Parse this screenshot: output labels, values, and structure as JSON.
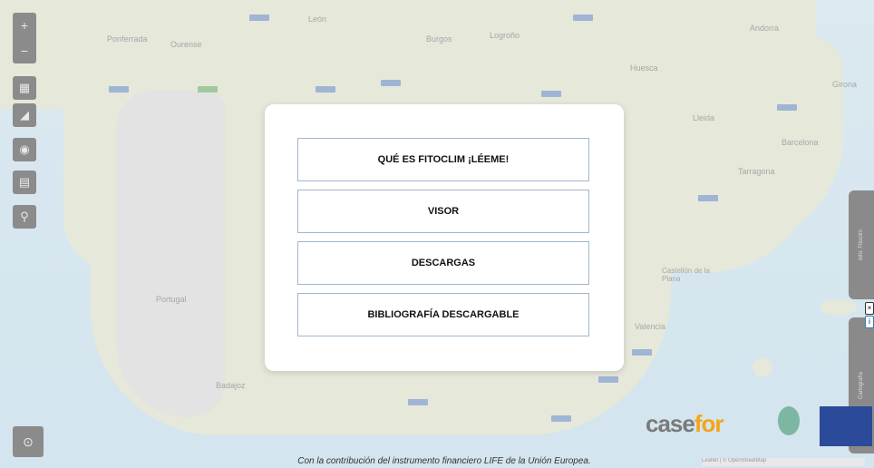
{
  "modal": {
    "buttons": [
      {
        "label": "QUÉ ES FITOCLIM ¡LÉEME!"
      },
      {
        "label": "VISOR"
      },
      {
        "label": "DESCARGAS"
      },
      {
        "label": "BIBLIOGRAFÍA DESCARGABLE"
      }
    ]
  },
  "map": {
    "labels": {
      "portugal": "Portugal",
      "barcelona": "Barcelona",
      "tarragona": "Tarragona",
      "lleida": "Lleida",
      "castellon": "Castellón de la Plana",
      "valencia": "Valencia",
      "badajoz": "Badajoz",
      "girona": "Girona",
      "andorra": "Andorra",
      "burgos": "Burgos",
      "logrono": "Logroño",
      "huesca": "Huesca",
      "ourense": "Ourense",
      "ponferrada": "Ponferrada",
      "leon": "León"
    }
  },
  "toolbar": {
    "zoom_in": "+",
    "zoom_out": "−",
    "icons": [
      "layers-icon",
      "measure-icon",
      "globe-icon",
      "document-icon",
      "search-icon"
    ],
    "location": "⊙"
  },
  "side_panels": {
    "upper": "Info: Fitoclim",
    "lower": "Cartografía"
  },
  "logos": {
    "casefor_a": "case",
    "casefor_b": "for"
  },
  "attribution": "Leaflet | © OpenStreetMap",
  "footer": "Con la contribución del instrumento financiero LIFE de la Unión Europea.",
  "colors": {
    "button_border": "#9fb7cf",
    "toolbar": "#8b8b8b",
    "casefor_orange": "#f3a516"
  }
}
